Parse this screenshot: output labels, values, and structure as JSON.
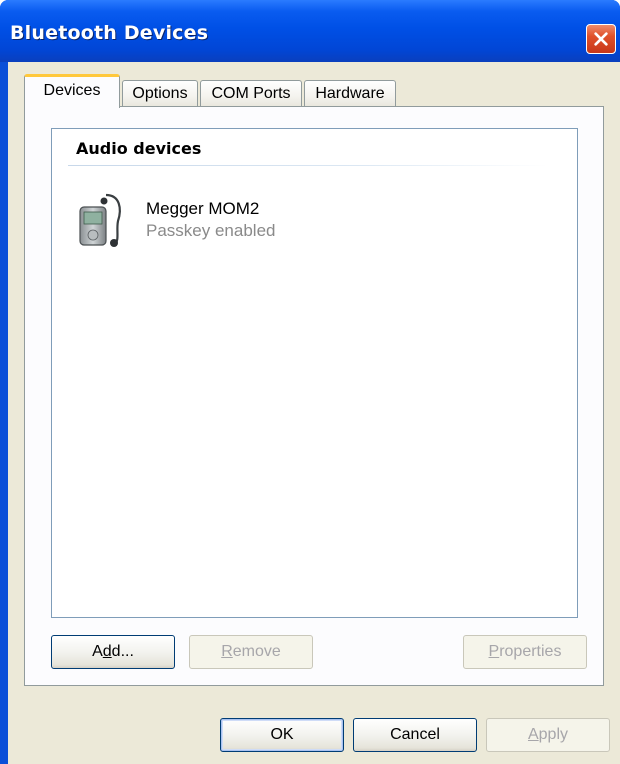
{
  "window": {
    "title": "Bluetooth Devices"
  },
  "tabs": [
    {
      "label": "Devices",
      "active": true
    },
    {
      "label": "Options",
      "active": false
    },
    {
      "label": "COM Ports",
      "active": false
    },
    {
      "label": "Hardware",
      "active": false
    }
  ],
  "devices_panel": {
    "group_header": "Audio devices",
    "devices": [
      {
        "name": "Megger MOM2",
        "status": "Passkey enabled",
        "icon": "audio-device-icon"
      }
    ],
    "buttons": {
      "add": {
        "label_pre": "A",
        "mnemonic": "d",
        "label_post": "d...",
        "enabled": true
      },
      "remove": {
        "label_pre": "",
        "mnemonic": "R",
        "label_post": "emove",
        "enabled": false
      },
      "properties": {
        "label_pre": "",
        "mnemonic": "P",
        "label_post": "roperties",
        "enabled": false
      }
    }
  },
  "dialog_buttons": {
    "ok": {
      "label": "OK",
      "enabled": true
    },
    "cancel": {
      "label": "Cancel",
      "enabled": true
    },
    "apply": {
      "label_pre": "",
      "mnemonic": "A",
      "label_post": "pply",
      "enabled": false
    }
  },
  "colors": {
    "titlebar": "#0050e6",
    "close_button": "#e0512a",
    "dialog_bg": "#ece9d8",
    "active_tab_accent": "#ffc83c",
    "status_text": "#8a8a8a"
  }
}
